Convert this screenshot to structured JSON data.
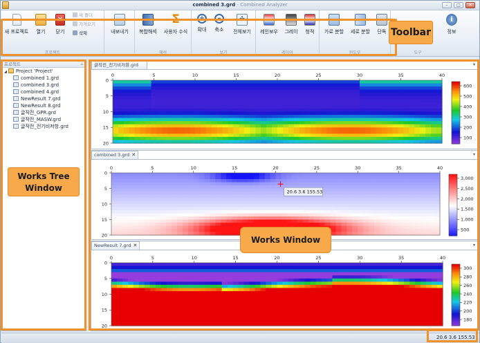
{
  "window": {
    "title_file": "combined 3.grd",
    "title_sep": " - ",
    "title_app": "Combined Analyzer"
  },
  "ribbon": {
    "groups": [
      {
        "label": "프로젝트"
      },
      {
        "label": "해석"
      },
      {
        "label": "보기"
      },
      {
        "label": "레이어"
      },
      {
        "label": "윈도우"
      },
      {
        "label": "도구"
      }
    ],
    "buttons": {
      "new_project": "새 프로젝트",
      "open": "열기",
      "close": "닫기",
      "new_folder": "새 폴더",
      "import": "가져오기",
      "delete": "삭제",
      "export": "내보내기",
      "composite": "복합해석",
      "user_formula": "사용자 수식",
      "zoom_in": "확대",
      "zoom_out": "축소",
      "view_all": "전체보기",
      "rainbow": "레인보우",
      "gray": "그레이",
      "blue_red": "청적",
      "tile_h": "가로 분할",
      "tile_v": "세로 분할",
      "single": "단독",
      "info": "정보"
    }
  },
  "tree": {
    "header": "프로젝트",
    "pin": "ᵖ",
    "root": "Project 'Project'",
    "items": [
      "combined 1.grd",
      "combined 3.grd",
      "combined 4.grd",
      "NewResult 7.grd",
      "NewResult 8.grd",
      "글작전_GPR.grd",
      "글작전_MASW.grd",
      "글작전_전기비저항.grd"
    ]
  },
  "documents": [
    {
      "tab": "글작전_전기비저항.grd",
      "closable": false
    },
    {
      "tab": "combined 3.grd",
      "closable": true
    },
    {
      "tab": "NewResult 7.grd",
      "closable": true
    }
  ],
  "tab_close": "✕",
  "tab_dropdown": "▾",
  "cursor_readout": "20.6   3.6   155.53",
  "status": {
    "coords": "20.6   3.6   155.53"
  },
  "annotations": {
    "toolbar": "Toolbar",
    "tree_line1": "Works Tree",
    "tree_line2": "Window",
    "works": "Works Window"
  },
  "chart_data": [
    {
      "type": "heatmap",
      "title": "글작전_전기비저항.grd",
      "x_ticks": [
        0,
        5,
        10,
        15,
        20,
        25,
        30,
        35,
        40
      ],
      "y_ticks": [
        0,
        5,
        10,
        15,
        20
      ],
      "xlim": [
        0,
        40
      ],
      "ylim": [
        20,
        0
      ],
      "colorbar_ticks": [
        100,
        200,
        300,
        400,
        500,
        600
      ],
      "colorscale": "rainbow"
    },
    {
      "type": "heatmap",
      "title": "combined 3.grd",
      "x_ticks": [
        0,
        5,
        10,
        15,
        20,
        25,
        30,
        35,
        40
      ],
      "y_ticks": [
        0,
        5,
        10,
        15,
        20
      ],
      "xlim": [
        0,
        40
      ],
      "ylim": [
        20,
        0
      ],
      "colorbar_ticks": [
        500,
        1000,
        1500,
        2000,
        2500,
        3000
      ],
      "colorbar_labels": [
        "500",
        "1,000",
        "1,500",
        "2,000",
        "2,500",
        "3,000"
      ],
      "colorscale": "blue-white-red",
      "cursor": {
        "x": 20.6,
        "y": 3.6,
        "value": 155.53
      }
    },
    {
      "type": "heatmap",
      "title": "NewResult 7.grd",
      "x_ticks": [
        0,
        5,
        10,
        15,
        20,
        25,
        30,
        35,
        40
      ],
      "y_ticks": [
        0,
        5,
        10,
        15,
        20
      ],
      "xlim": [
        0,
        40
      ],
      "ylim": [
        20,
        0
      ],
      "colorbar_ticks": [
        180,
        200,
        220,
        240,
        260,
        280,
        300
      ],
      "colorscale": "rainbow"
    }
  ],
  "colors": {
    "annotation": "#f0922b",
    "annotation_fill": "#f8a94a"
  }
}
